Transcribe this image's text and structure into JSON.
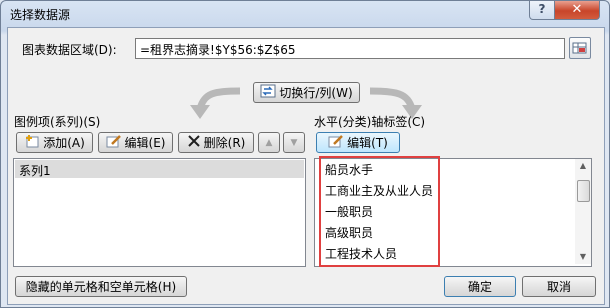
{
  "window": {
    "title": "选择数据源",
    "help_label": "?",
    "close_label": "✕"
  },
  "data_range": {
    "label": "图表数据区域(D):",
    "value": "=租界志摘录!$Y$56:$Z$65"
  },
  "switch_button": {
    "label": "切换行/列(W)"
  },
  "series_panel": {
    "label": "图例项(系列)(S)",
    "add_label": "添加(A)",
    "edit_label": "编辑(E)",
    "delete_label": "删除(R)",
    "up_label": "▲",
    "down_label": "▼",
    "items": [
      "系列1"
    ]
  },
  "category_panel": {
    "label": "水平(分类)轴标签(C)",
    "edit_label": "编辑(T)",
    "items": [
      "船员水手",
      "工商业主及从业人员",
      "一般职员",
      "高级职员",
      "工程技术人员"
    ]
  },
  "footer": {
    "hidden_cells_label": "隐藏的单元格和空单元格(H)",
    "ok_label": "确定",
    "cancel_label": "取消"
  },
  "colors": {
    "highlight": "#e04040",
    "accent": "#4a8ad8"
  }
}
